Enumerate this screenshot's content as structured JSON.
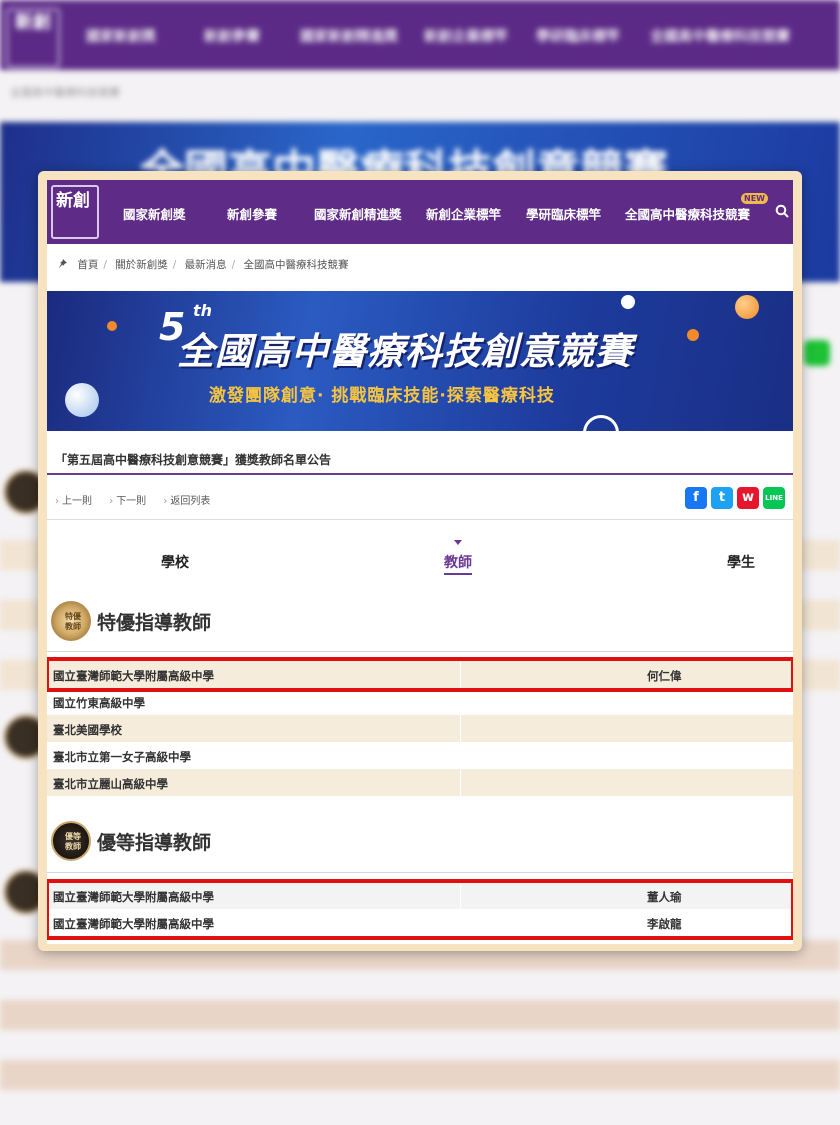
{
  "header": {
    "logo_text": "新創",
    "nav": [
      "國家新創獎",
      "新創參賽",
      "國家新創精進獎",
      "新創企業標竿",
      "學研臨床標竿",
      "全國高中醫療科技競賽"
    ],
    "new_badge": "NEW"
  },
  "breadcrumb": [
    "首頁",
    "關於新創獎",
    "最新消息",
    "全國高中醫療科技競賽"
  ],
  "banner": {
    "edition_number": "5",
    "edition_suffix": "th",
    "title": "全國高中醫療科技創意競賽",
    "subtitle": "激發團隊創意· 挑戰臨床技能·探索醫療科技"
  },
  "announcement": {
    "title": "「第五屆高中醫療科技創意競賽」獲獎教師名單公告",
    "prev": "上一則",
    "next": "下一則",
    "back": "返回列表"
  },
  "share": {
    "facebook": "f",
    "twitter": "t",
    "weibo": "w",
    "line": "LINE"
  },
  "tabs": {
    "school": "學校",
    "teacher": "教師",
    "student": "學生"
  },
  "sections": {
    "special": {
      "title": "特優指導教師",
      "medal_text": "特優教師",
      "rows": [
        {
          "school": "國立臺灣師範大學附屬高級中學",
          "teacher": "何仁偉"
        },
        {
          "school": "國立竹東高級中學",
          "teacher": ""
        },
        {
          "school": "臺北美國學校",
          "teacher": ""
        },
        {
          "school": "臺北市立第一女子高級中學",
          "teacher": ""
        },
        {
          "school": "臺北市立麗山高級中學",
          "teacher": ""
        }
      ]
    },
    "excellent": {
      "title": "優等指導教師",
      "medal_text": "優等教師",
      "rows": [
        {
          "school": "國立臺灣師範大學附屬高級中學",
          "teacher": "董人瑜"
        },
        {
          "school": "國立臺灣師範大學附屬高級中學",
          "teacher": "李啟龍"
        }
      ]
    }
  },
  "colors": {
    "brand_purple": "#5e2b87",
    "accent_gold": "#f6c440",
    "highlight_red": "#e01010",
    "row_shade": "#f6ecdc"
  }
}
